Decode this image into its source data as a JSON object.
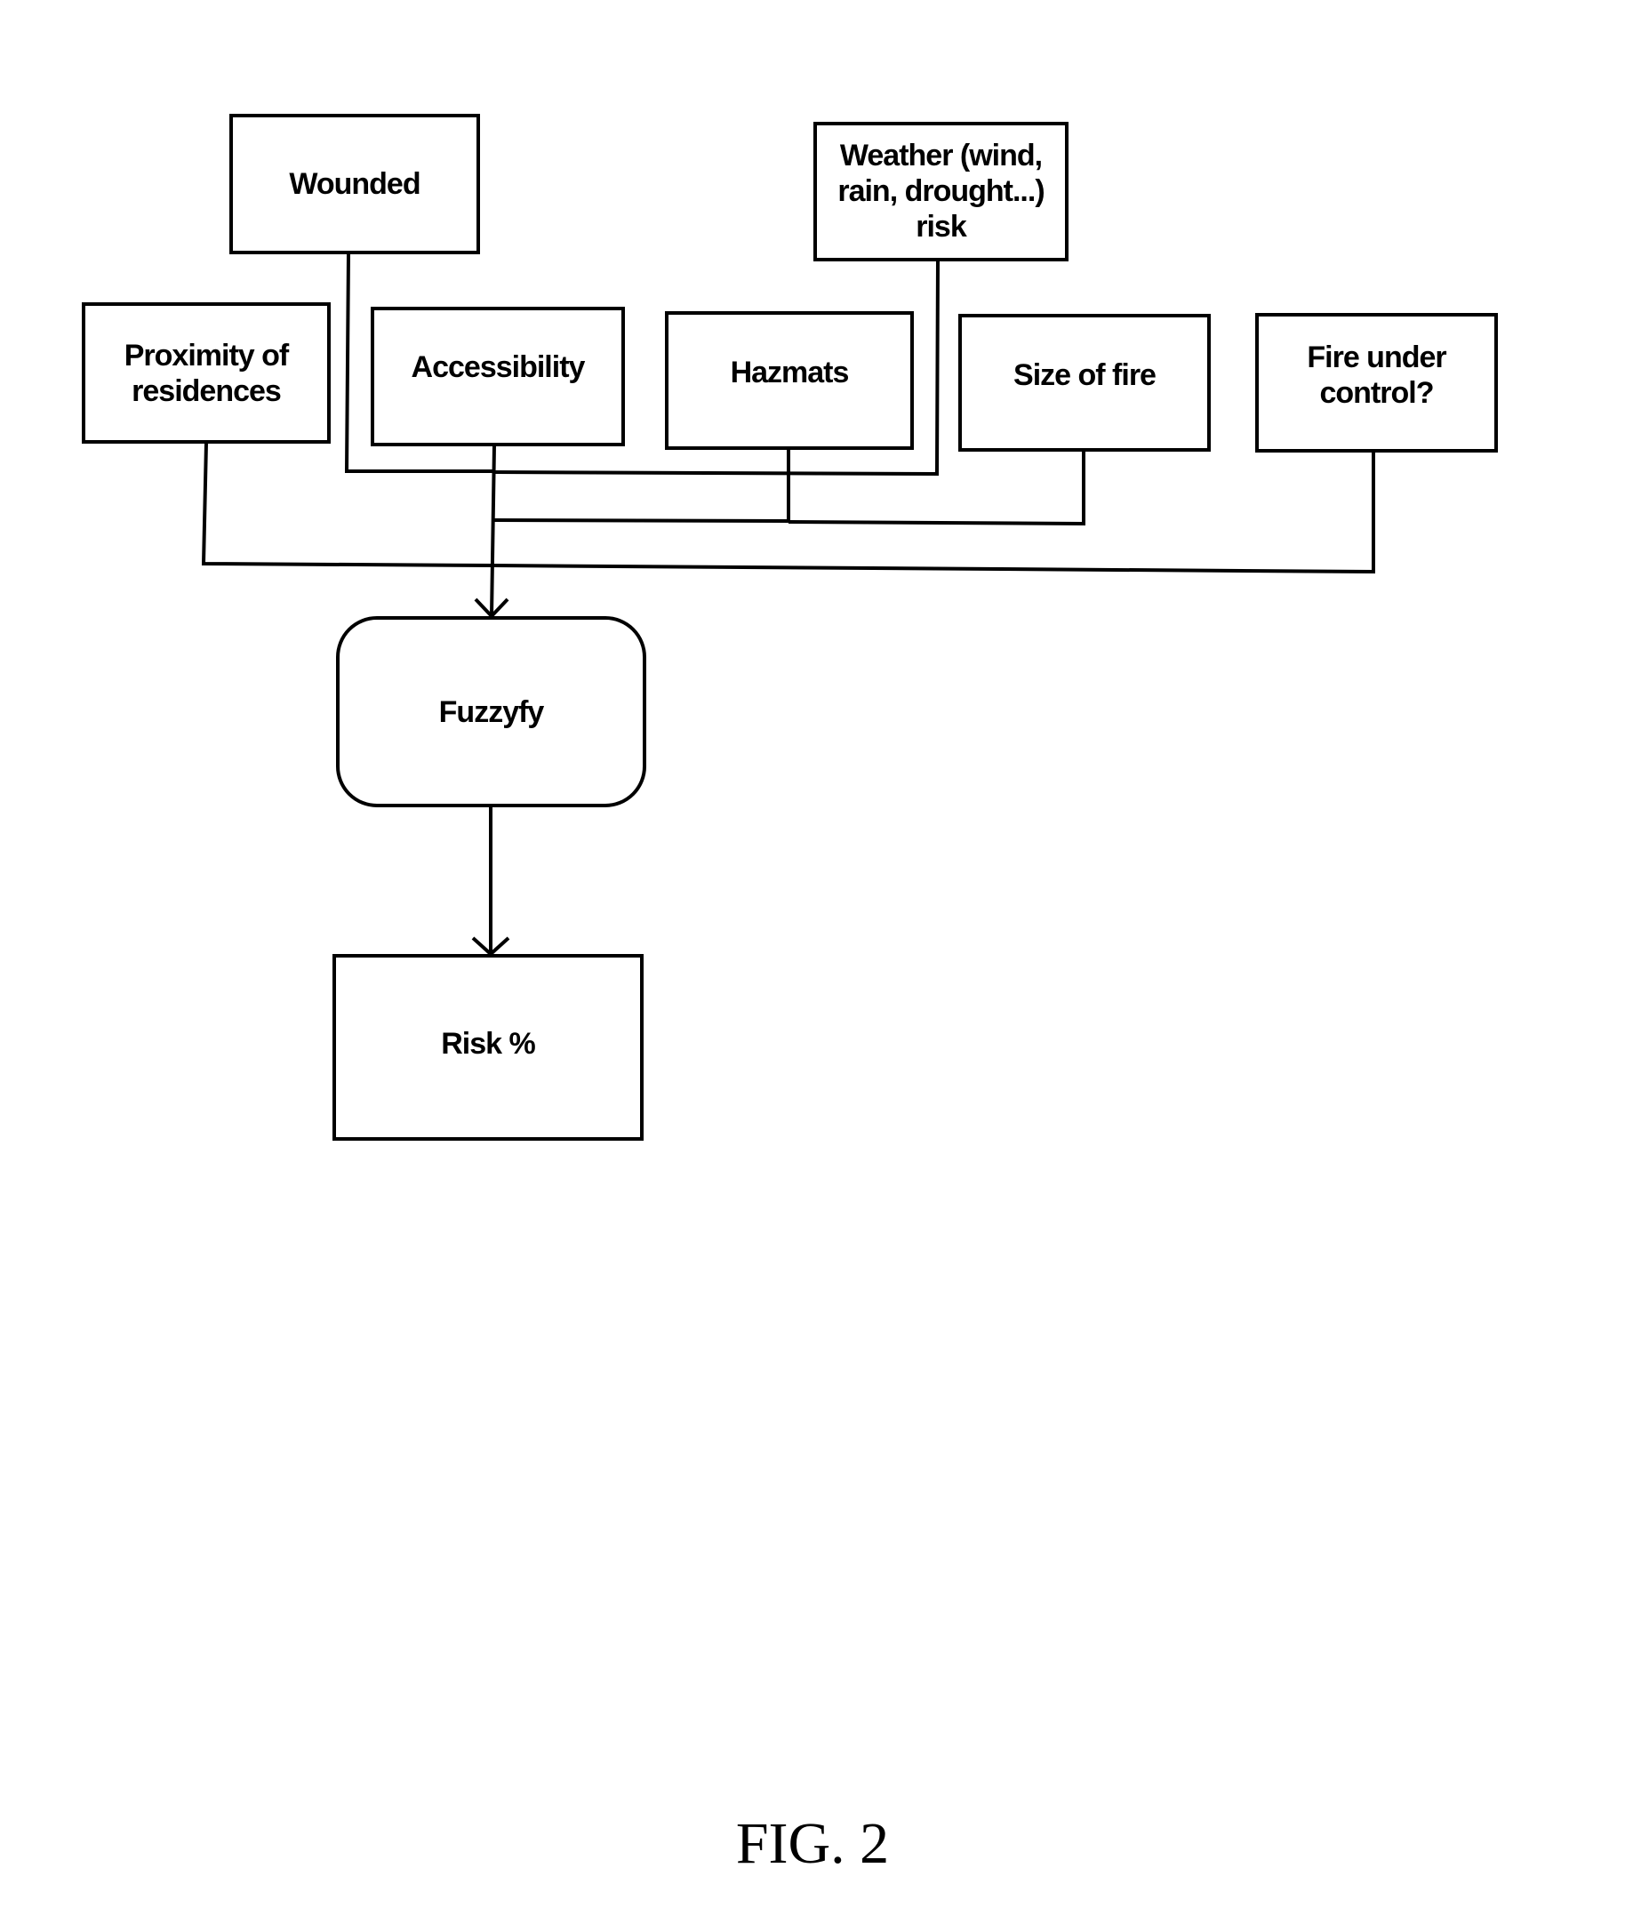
{
  "figure": {
    "caption": "FIG. 2",
    "nodes": {
      "wounded": "Wounded",
      "weather": "Weather (wind,\nrain, drought...)\nrisk",
      "proximity": "Proximity of\nresidences",
      "accessibility": "Accessibility",
      "hazmats": "Hazmats",
      "size_of_fire": "Size of fire",
      "fire_under_control": "Fire under\ncontrol?",
      "fuzzyfy": "Fuzzyfy",
      "risk": "Risk %"
    },
    "edges": [
      {
        "from": "wounded",
        "to": "fuzzyfy"
      },
      {
        "from": "weather",
        "to": "fuzzyfy"
      },
      {
        "from": "proximity",
        "to": "fuzzyfy"
      },
      {
        "from": "accessibility",
        "to": "fuzzyfy"
      },
      {
        "from": "hazmats",
        "to": "fuzzyfy"
      },
      {
        "from": "size_of_fire",
        "to": "fuzzyfy"
      },
      {
        "from": "fire_under_control",
        "to": "fuzzyfy"
      },
      {
        "from": "fuzzyfy",
        "to": "risk"
      }
    ]
  }
}
